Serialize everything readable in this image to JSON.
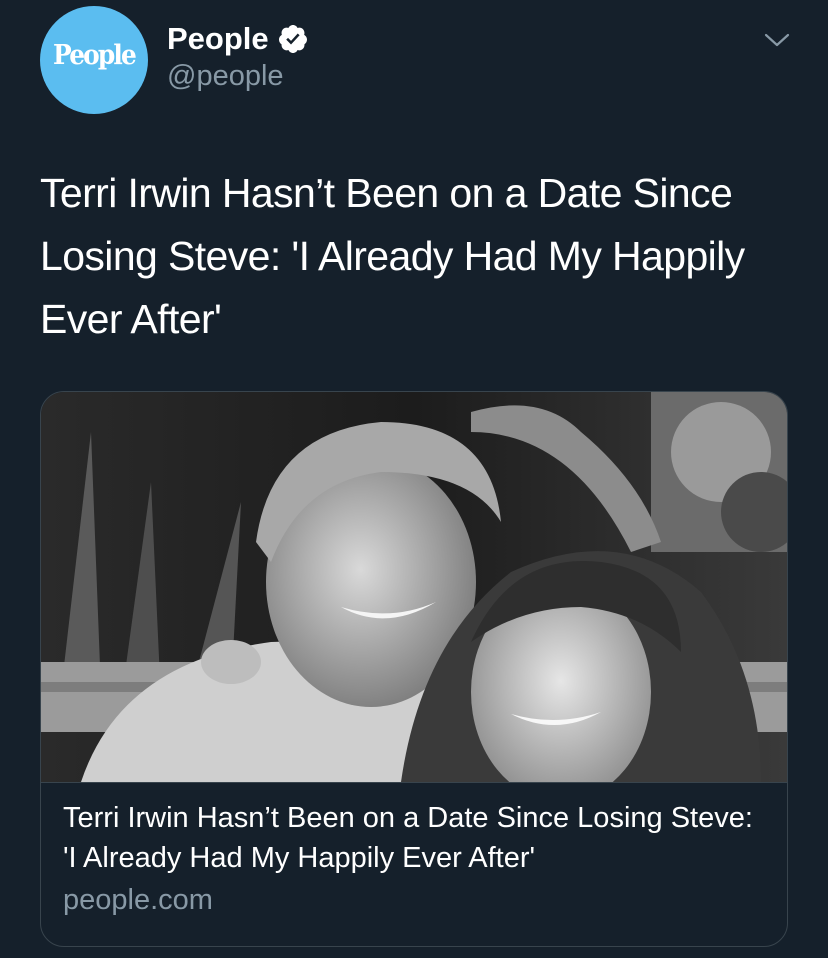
{
  "colors": {
    "background": "#15202b",
    "avatar": "#5bbdf0",
    "verified": "#ffffff",
    "secondary_text": "#8899a6",
    "border": "#38444d"
  },
  "account": {
    "avatar_text": "People",
    "display_name": "People",
    "handle": "@people",
    "verified_icon": "verified-badge-icon"
  },
  "menu": {
    "icon": "chevron-down-icon"
  },
  "tweet": {
    "text": "Terri Irwin Hasn’t Been on a Date Since Losing Steve: 'I Already Had My Happily Ever After'"
  },
  "card": {
    "image_icon": "photo",
    "title": "Terri Irwin Hasn’t Been on a Date Since Losing Steve: 'I Already Had My Happily Ever After'",
    "domain": "people.com"
  }
}
